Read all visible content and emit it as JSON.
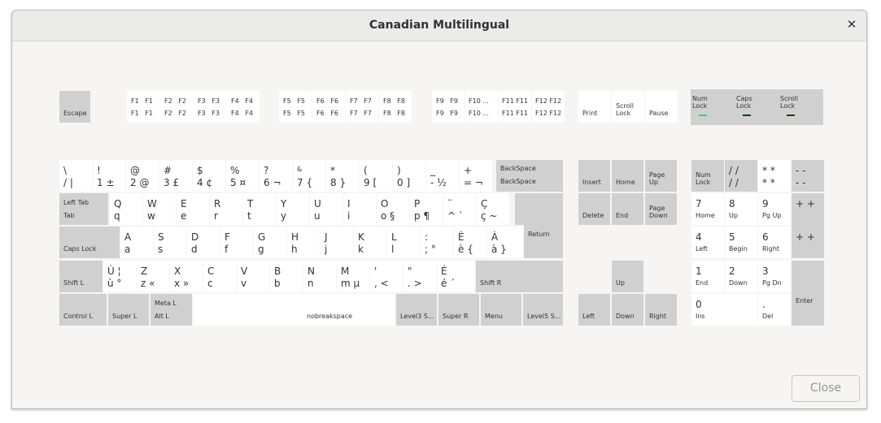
{
  "window": {
    "title": "Canadian Multilingual",
    "close_button": "Close"
  },
  "leds": [
    {
      "label": "Num\nLock",
      "on": true,
      "color": "#33d17a"
    },
    {
      "label": "Caps\nLock",
      "on": false,
      "color": "#1c3b1f"
    },
    {
      "label": "Scroll\nLock",
      "on": false,
      "color": "#1c3b1f"
    }
  ],
  "keys": {
    "esc": "Escape",
    "f1_top": "F1   F1",
    "f1_bot": "F1   F1",
    "f2_top": "F2   F2",
    "f2_bot": "F2   F2",
    "f3_top": "F3   F3",
    "f3_bot": "F3   F3",
    "f4_top": "F4   F4",
    "f4_bot": "F4   F4",
    "f5_top": "F5   F5",
    "f5_bot": "F5   F5",
    "f6_top": "F6   F6",
    "f6_bot": "F6   F6",
    "f7_top": "F7   F7",
    "f7_bot": "F7   F7",
    "f8_top": "F8   F8",
    "f8_bot": "F8   F8",
    "f9_top": "F9   F9",
    "f9_bot": "F9   F9",
    "f10_top": "F10 ...",
    "f10_bot": "F10 ...",
    "f11_top": "F11 F11",
    "f11_bot": "F11 F11",
    "f12_top": "F12 F12",
    "f12_bot": "F12 F12",
    "print": "Print",
    "scroll_lock": "Scroll\nLock",
    "pause": "Pause",
    "grave_top": "\\",
    "grave_bot": "/   |",
    "k1_top": "!",
    "k1_bot": "1  ±",
    "k2_top": "@",
    "k2_bot": "2  @",
    "k3_top": "#",
    "k3_bot": "3  £",
    "k4_top": "$",
    "k4_bot": "4  ¢",
    "k5_top": "%",
    "k5_bot": "5  ¤",
    "k6_top": "?",
    "k6_bot": "6  ¬",
    "k7_top": "&",
    "k7_bot": "7  {",
    "k8_top": "*",
    "k8_bot": "8  }",
    "k9_top": "(",
    "k9_bot": "9  [",
    "k0_top": ")",
    "k0_bot": "0  ]",
    "minus_top": "_",
    "minus_bot": "-  ½",
    "equal_top": "+",
    "equal_bot": "=  ¬",
    "backspace_top": "BackSpace",
    "backspace_bot": "BackSpace",
    "tab_top": "Left Tab",
    "tab_bot": "Tab",
    "q_top": "Q",
    "q_bot": "q",
    "w_top": "W",
    "w_bot": "w",
    "e_top": "E",
    "e_bot": "e",
    "r_top": "R",
    "r_bot": "r",
    "t_top": "T",
    "t_bot": "t",
    "y_top": "Y",
    "y_bot": "y",
    "u_top": "U",
    "u_bot": "u",
    "i_top": "I",
    "i_bot": "i",
    "o_top": "O",
    "o_bot": "o  §",
    "p_top": "P",
    "p_bot": "p  ¶",
    "lbr_top": "¨",
    "lbr_bot": "^  `",
    "rbr_top": "Ç",
    "rbr_bot": "ç  ~",
    "return": "Return",
    "caps": "Caps Lock",
    "a_top": "A",
    "a_bot": "a",
    "s_top": "S",
    "s_bot": "s",
    "d_top": "D",
    "d_bot": "d",
    "f_top": "F",
    "f_bot": "f",
    "g_top": "G",
    "g_bot": "g",
    "h_top": "H",
    "h_bot": "h",
    "j_top": "J",
    "j_bot": "j",
    "k_top": "K",
    "k_bot": "k",
    "l_top": "L",
    "l_bot": "l",
    "semi_top": ":",
    "semi_bot": ";  °",
    "apos_top": "È",
    "apos_bot": "è  {",
    "hash_top": "À",
    "hash_bot": "à  }",
    "shift_l": "Shift L",
    "lsgt_top": "Ù  ¦",
    "lsgt_bot": "ù  °",
    "z_top": "Z",
    "z_bot": "z  «",
    "x_top": "X",
    "x_bot": "x  »",
    "c_top": "C",
    "c_bot": "c",
    "v_top": "V",
    "v_bot": "v",
    "b_top": "B",
    "b_bot": "b",
    "n_top": "N",
    "n_bot": "n",
    "m_top": "M",
    "m_bot": "m  µ",
    "comma_top": "'",
    "comma_bot": ",   <",
    "period_top": "\"",
    "period_bot": ".   >",
    "slash_top": "É",
    "slash_bot": "é  ´",
    "shift_r": "Shift R",
    "ctrl_l": "Control L",
    "super_l": "Super L",
    "alt_top": "Meta L",
    "alt_bot": "Alt L",
    "space": "nobreakspace",
    "altgr": "Level3 S...",
    "super_r": "Super R",
    "menu": "Menu",
    "ctrl_r": "Level5 S...",
    "insert": "Insert",
    "home": "Home",
    "pgup": "Page\nUp",
    "delete": "Delete",
    "end": "End",
    "pgdn": "Page\nDown",
    "up": "Up",
    "left": "Left",
    "down": "Down",
    "right": "Right",
    "numlock": "Num\nLock",
    "kpdiv_top": "/    /",
    "kpdiv_bot": "/    /",
    "kpmul_top": "*    *",
    "kpmul_bot": "*    *",
    "kpsub_top": "-    -",
    "kpsub_bot": "-    -",
    "kp7_top": "7",
    "kp7_bot": "Home",
    "kp8_top": "8",
    "kp8_bot": "Up",
    "kp9_top": "9",
    "kp9_bot": "Pg Up",
    "kpadd_top": "+    +",
    "kpadd_mid": "+    +",
    "kp4_top": "4",
    "kp4_bot": "Left",
    "kp5_top": "5",
    "kp5_bot": "Begin",
    "kp6_top": "6",
    "kp6_bot": "Right",
    "kp1_top": "1",
    "kp1_bot": "End",
    "kp2_top": "2",
    "kp2_bot": "Down",
    "kp3_top": "3",
    "kp3_bot": "Pg Dn",
    "kpenter": "Enter",
    "kp0_top": "0",
    "kp0_bot": "Ins",
    "kpdot_top": ".",
    "kpdot_bot": "Del"
  }
}
